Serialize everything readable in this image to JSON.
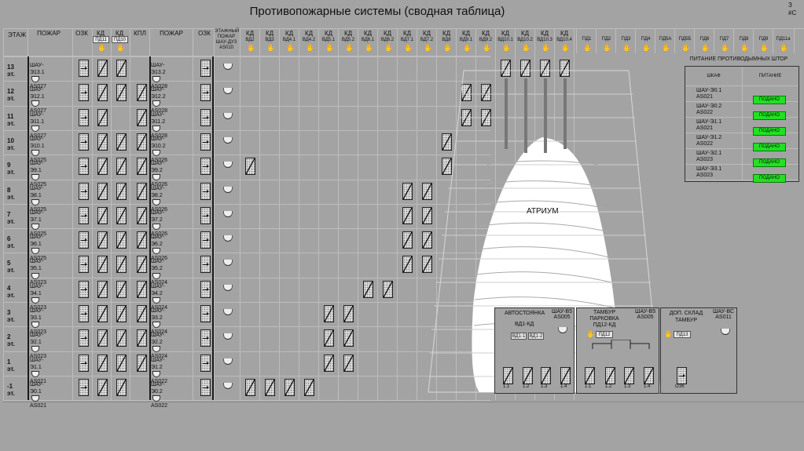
{
  "window": {
    "title": "Противопожарные системы (сводная таблица)",
    "corner_a": "З",
    "corner_b": "#С"
  },
  "headers": {
    "floor": "ЭТАЖ",
    "fire": "ПОЖАР",
    "ozk": "ОЗК",
    "kd": "КД",
    "kpl": "КПЛ",
    "fire2": "ПОЖАР",
    "ozk2": "ОЗК",
    "floor_fire": "ЭТАЖНЫЙ ПОЖАР ШАУ-ДУ3 AS010"
  },
  "pd_left": [
    "ПД11",
    "ПД10"
  ],
  "vd_cols": [
    "ВД2",
    "ВД3",
    "ВД4.1",
    "ВД4.2",
    "ВД5.1",
    "ВД5.2",
    "ВД6.1",
    "ВД6.2",
    "ВД7.1",
    "ВД7.2",
    "ВД8",
    "ВД9.1",
    "ВД9.2",
    "ВД10.1",
    "ВД10.2",
    "ВД10.3",
    "ВД10.4"
  ],
  "pd_right": [
    "ПД1",
    "ПД2",
    "ПД3",
    "ПД4",
    "ПД5А",
    "ПД5Б",
    "ПД6",
    "ПД7",
    "ПД8",
    "ПД9",
    "ПД11а"
  ],
  "floors": [
    {
      "label": "13 эт.",
      "shau": "ШАУ-Э13.1",
      "as": "AS027",
      "shau2": "ШАУ-Э13.2",
      "as2": "AS028"
    },
    {
      "label": "12 эт.",
      "shau": "ШАУ-Э12.1",
      "as": "AS027",
      "shau2": "ШАУ-Э12.2",
      "as2": "AS028"
    },
    {
      "label": "11 эт.",
      "shau": "ШАУ-Э11.1",
      "as": "AS027",
      "shau2": "ШАУ-Э11.2",
      "as2": "AS028"
    },
    {
      "label": "10 эт.",
      "shau": "ШАУ-Э10.1",
      "as": "AS025",
      "shau2": "ШАУ-Э10.2",
      "as2": "AS026"
    },
    {
      "label": "9 эт.",
      "shau": "ШАУ-Э9.1",
      "as": "AS025",
      "shau2": "ШАУ-Э9.2",
      "as2": "AS026"
    },
    {
      "label": "8 эт.",
      "shau": "ШАУ-Э8.1",
      "as": "AS025",
      "shau2": "ШАУ-Э8.2",
      "as2": "AS026"
    },
    {
      "label": "7 эт.",
      "shau": "ШАУ-Э7.1",
      "as": "AS025",
      "shau2": "ШАУ-Э7.2",
      "as2": "AS026"
    },
    {
      "label": "6 эт.",
      "shau": "ШАУ-Э6.1",
      "as": "AS025",
      "shau2": "ШАУ-Э6.2",
      "as2": "AS026"
    },
    {
      "label": "5 эт.",
      "shau": "ШАУ-Э5.1",
      "as": "AS023",
      "shau2": "ШАУ-Э5.2",
      "as2": "AS024"
    },
    {
      "label": "4 эт.",
      "shau": "ШАУ-Э4.1",
      "as": "AS023",
      "shau2": "ШАУ-Э4.2",
      "as2": "AS024"
    },
    {
      "label": "3 эт.",
      "shau": "ШАУ-Э3.1",
      "as": "AS023",
      "shau2": "ШАУ-Э3.2",
      "as2": "AS024"
    },
    {
      "label": "2 эт.",
      "shau": "ШАУ-Э2.1",
      "as": "AS023",
      "shau2": "ШАУ-Э2.2",
      "as2": "AS024"
    },
    {
      "label": "1 эт.",
      "shau": "ШАУ-Э1.1",
      "as": "AS021",
      "shau2": "ШАУ-Э1.2",
      "as2": "AS022"
    },
    {
      "label": "-1 эт.",
      "shau": "ШАУ-Э0.1",
      "as": "AS021",
      "shau2": "ШАУ-Э0.2",
      "as2": "AS022"
    }
  ],
  "atrium": {
    "label": "АТРИУМ"
  },
  "power": {
    "title": "ПИТАНИЕ ПРОТИВОДЫМНЫХ ШТОР",
    "col_cab": "ШКАФ",
    "col_pow": "ПИТАНИЕ",
    "rows": [
      {
        "a": "ШАУ-Э0.1",
        "b": "AS021",
        "status": "ПОДАНО"
      },
      {
        "a": "ШАУ-Э0.2",
        "b": "AS022",
        "status": "ПОДАНО"
      },
      {
        "a": "ШАУ-Э1.1",
        "b": "AS021",
        "status": "ПОДАНО"
      },
      {
        "a": "ШАУ-Э1.2",
        "b": "AS022",
        "status": "ПОДАНО"
      },
      {
        "a": "ШАУ-Э2.1",
        "b": "AS023",
        "status": "ПОДАНО"
      },
      {
        "a": "ШАУ-Э3.1",
        "b": "AS023",
        "status": "ПОДАНО"
      }
    ]
  },
  "parking": {
    "title": "АВТОСТОЯНКА",
    "shau": "ШАУ-В5",
    "as": "AS005",
    "vd": "ВД1-КД",
    "b1": "ВД1-1",
    "b2": "ВД1-2",
    "dampers": [
      "1.1",
      "1.2",
      "1.3",
      "1.4"
    ]
  },
  "tambur": {
    "title1": "ТАМБУР",
    "title2": "ПАРКОВКА",
    "title3": "ПД12-КД",
    "shau": "ШАУ-В5",
    "as": "AS005",
    "pd": "ПД12",
    "dampers": [
      "1.1",
      "1.2",
      "1.3",
      "1.4"
    ]
  },
  "storage": {
    "title1": "ДОП. СКЛАД",
    "title2": "ТАМБУР",
    "shau": "ШАУ-ВС",
    "as": "AS011",
    "pd": "ПД13",
    "ozk": "ОЗК"
  }
}
